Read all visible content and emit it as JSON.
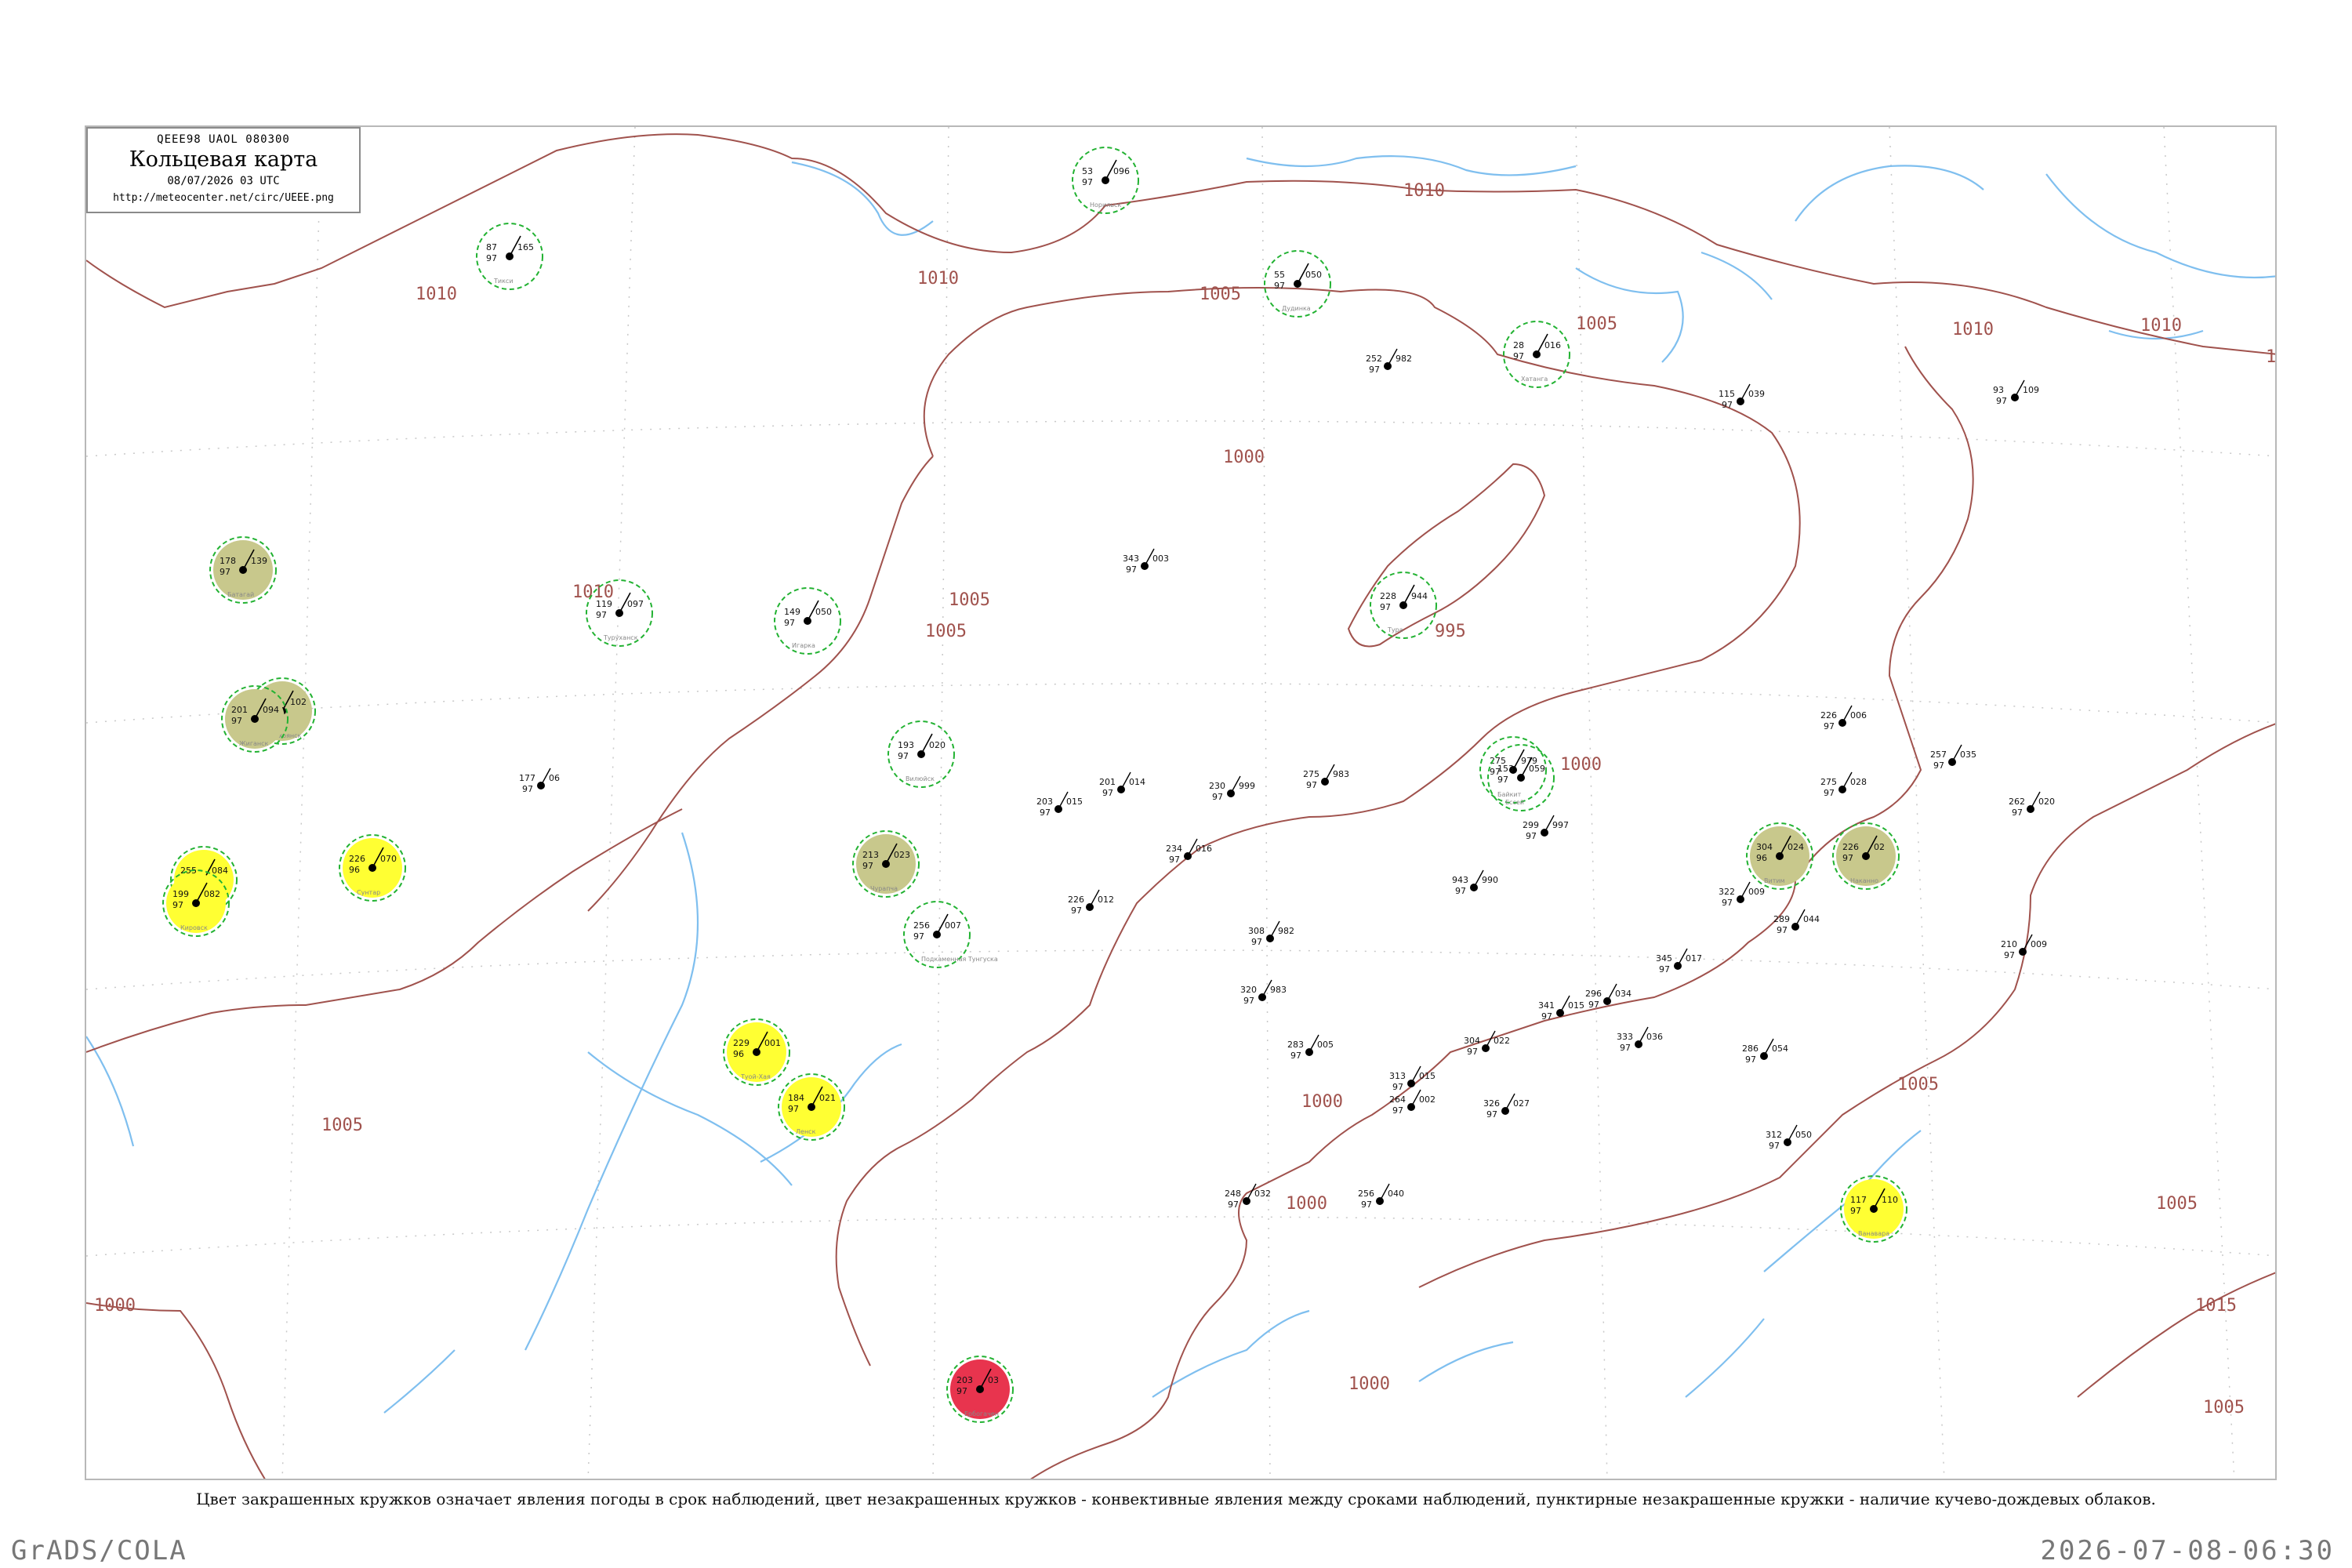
{
  "header": {
    "code_line": "QEEE98  UAOL  080300",
    "title": "Кольцевая карта",
    "datetime": "08/07/2026 03 UTC",
    "url": "http://meteocenter.net/circ/UEEE.png"
  },
  "caption": "Цвет закрашенных кружков означает явления погоды в срок наблюдений, цвет незакрашенных кружков - конвективные явления между сроками наблюдений, пунктирные незакрашенные кружки - наличие кучево-дождевых облаков.",
  "footer": {
    "left": "GrADS/COLA",
    "right": "2026-07-08-06:30"
  },
  "colors": {
    "isobar": "#a0524d",
    "water": "#7fbfef",
    "rain": "#12c12c",
    "fog_haze": "#c8c88c",
    "dust": "#ffff33",
    "thunder": "#e8344e",
    "dashed_ring": "#22b232"
  },
  "isobars": {
    "labels": [
      "1010",
      "1010",
      "1010",
      "1010",
      "1010",
      "1010",
      "1010",
      "1010",
      "1005",
      "1005",
      "1005",
      "1005",
      "1005",
      "1005",
      "1005",
      "1005",
      "1005",
      "1005",
      "1000",
      "1000",
      "1000",
      "1000",
      "1000",
      "1000",
      "995",
      "1015"
    ]
  },
  "stations": [
    {
      "name": "Тикси",
      "temp": "87",
      "dew": "97",
      "pres": "165",
      "wx": "ring"
    },
    {
      "name": "Батагай",
      "temp": "178",
      "dew": "97",
      "pres": "139",
      "wx": "fog"
    },
    {
      "name": "Верхоянск",
      "temp": "190",
      "dew": "07",
      "pres": "102",
      "wx": "fog"
    },
    {
      "name": "Жиганск",
      "temp": "201",
      "dew": "97",
      "pres": "094",
      "wx": "fog"
    },
    {
      "name": "Олекминск",
      "temp": "255",
      "dew": "97",
      "pres": "084",
      "wx": "dust"
    },
    {
      "name": "Кировск",
      "temp": "199",
      "dew": "97",
      "pres": "082",
      "wx": "dust"
    },
    {
      "name": "Сунтар",
      "temp": "226",
      "dew": "96",
      "pres": "070",
      "wx": "dust"
    },
    {
      "name": "Чурапча",
      "temp": "213",
      "dew": "97",
      "pres": "023",
      "wx": "fog"
    },
    {
      "name": "Туой-Хая",
      "temp": "229",
      "dew": "96",
      "pres": "001",
      "wx": "dust"
    },
    {
      "name": "Ленск",
      "temp": "184",
      "dew": "97",
      "pres": "021",
      "wx": "dust"
    },
    {
      "name": "Витим",
      "temp": "304",
      "dew": "96",
      "pres": "024",
      "wx": "fog"
    },
    {
      "name": "Наканно",
      "temp": "226",
      "dew": "97",
      "pres": "02",
      "wx": "fog"
    },
    {
      "name": "Ванавара",
      "temp": "117",
      "dew": "97",
      "pres": "110",
      "wx": "dust"
    },
    {
      "name": "Ербогачен",
      "temp": "203",
      "dew": "97",
      "pres": "03",
      "wx": "thunder"
    },
    {
      "name": "Туруханск",
      "temp": "119",
      "dew": "97",
      "pres": "097",
      "wx": "ring"
    },
    {
      "name": "Дудинка",
      "temp": "55",
      "dew": "97",
      "pres": "050",
      "wx": "ring"
    },
    {
      "name": "Норильск",
      "temp": "53",
      "dew": "97",
      "pres": "096",
      "wx": "ring"
    },
    {
      "name": "Хатанга",
      "temp": "28",
      "dew": "97",
      "pres": "016",
      "wx": "ring"
    },
    {
      "name": "Игарка",
      "temp": "149",
      "dew": "97",
      "pres": "050",
      "wx": "ring"
    },
    {
      "name": "Тура",
      "temp": "228",
      "dew": "97",
      "pres": "944",
      "wx": "ring"
    },
    {
      "name": "Байкит",
      "temp": "275",
      "dew": "97",
      "pres": "979",
      "wx": "ring"
    },
    {
      "name": "Подкаменная Тунгуска",
      "temp": "256",
      "dew": "97",
      "pres": "007",
      "wx": "ring"
    },
    {
      "name": "Ессей",
      "temp": "153",
      "dew": "97",
      "pres": "059",
      "wx": "ring"
    },
    {
      "name": "Вилюйск",
      "temp": "193",
      "dew": "97",
      "pres": "020",
      "wx": "ring"
    }
  ],
  "plain_labels": [
    {
      "t1": "226",
      "t2": "97",
      "p": "006"
    },
    {
      "t1": "275",
      "t2": "97",
      "p": "028"
    },
    {
      "t1": "257",
      "t2": "97",
      "p": "035"
    },
    {
      "t1": "262",
      "t2": "97",
      "p": "020"
    },
    {
      "t1": "210",
      "t2": "97",
      "p": "009"
    },
    {
      "t1": "322",
      "t2": "97",
      "p": "009"
    },
    {
      "t1": "345",
      "t2": "97",
      "p": "017"
    },
    {
      "t1": "296",
      "t2": "97",
      "p": "034"
    },
    {
      "t1": "333",
      "t2": "97",
      "p": "036"
    },
    {
      "t1": "286",
      "t2": "97",
      "p": "054"
    },
    {
      "t1": "312",
      "t2": "97",
      "p": "050"
    },
    {
      "t1": "343",
      "t2": "97",
      "p": "003"
    },
    {
      "t1": "230",
      "t2": "97",
      "p": "999"
    },
    {
      "t1": "308",
      "t2": "97",
      "p": "982"
    },
    {
      "t1": "320",
      "t2": "97",
      "p": "983"
    },
    {
      "t1": "283",
      "t2": "97",
      "p": "005"
    },
    {
      "t1": "304",
      "t2": "97",
      "p": "022"
    },
    {
      "t1": "313",
      "t2": "97",
      "p": "015"
    },
    {
      "t1": "326",
      "t2": "97",
      "p": "027"
    },
    {
      "t1": "264",
      "t2": "97",
      "p": "002"
    },
    {
      "t1": "248",
      "t2": "97",
      "p": "032"
    },
    {
      "t1": "256",
      "t2": "97",
      "p": "040"
    },
    {
      "t1": "289",
      "t2": "97",
      "p": "044"
    },
    {
      "t1": "341",
      "t2": "97",
      "p": "015"
    },
    {
      "t1": "299",
      "t2": "97",
      "p": "997"
    },
    {
      "t1": "943",
      "t2": "97",
      "p": "990"
    },
    {
      "t1": "115",
      "t2": "97",
      "p": "039"
    },
    {
      "t1": "93",
      "t2": "97",
      "p": "109"
    },
    {
      "t1": "252",
      "t2": "97",
      "p": "982"
    },
    {
      "t1": "201",
      "t2": "97",
      "p": "014"
    },
    {
      "t1": "203",
      "t2": "97",
      "p": "015"
    },
    {
      "t1": "226",
      "t2": "97",
      "p": "012"
    },
    {
      "t1": "234",
      "t2": "97",
      "p": "016"
    },
    {
      "t1": "275",
      "t2": "97",
      "p": "983"
    },
    {
      "t1": "177",
      "t2": "97",
      "p": "06"
    }
  ]
}
